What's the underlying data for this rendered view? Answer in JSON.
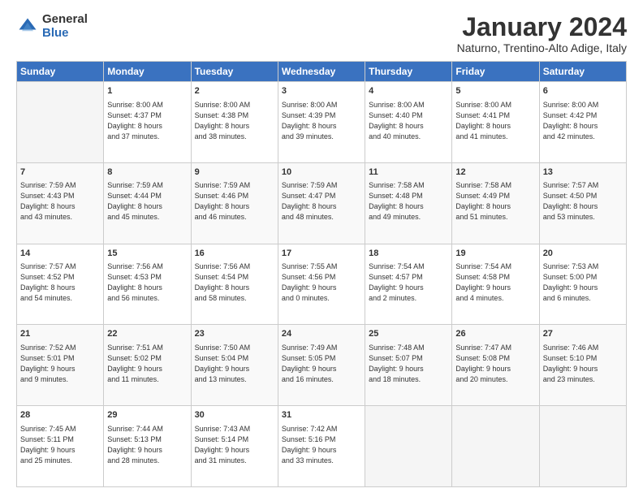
{
  "logo": {
    "general": "General",
    "blue": "Blue"
  },
  "title": "January 2024",
  "location": "Naturno, Trentino-Alto Adige, Italy",
  "weekdays": [
    "Sunday",
    "Monday",
    "Tuesday",
    "Wednesday",
    "Thursday",
    "Friday",
    "Saturday"
  ],
  "weeks": [
    [
      {
        "day": "",
        "info": ""
      },
      {
        "day": "1",
        "info": "Sunrise: 8:00 AM\nSunset: 4:37 PM\nDaylight: 8 hours\nand 37 minutes."
      },
      {
        "day": "2",
        "info": "Sunrise: 8:00 AM\nSunset: 4:38 PM\nDaylight: 8 hours\nand 38 minutes."
      },
      {
        "day": "3",
        "info": "Sunrise: 8:00 AM\nSunset: 4:39 PM\nDaylight: 8 hours\nand 39 minutes."
      },
      {
        "day": "4",
        "info": "Sunrise: 8:00 AM\nSunset: 4:40 PM\nDaylight: 8 hours\nand 40 minutes."
      },
      {
        "day": "5",
        "info": "Sunrise: 8:00 AM\nSunset: 4:41 PM\nDaylight: 8 hours\nand 41 minutes."
      },
      {
        "day": "6",
        "info": "Sunrise: 8:00 AM\nSunset: 4:42 PM\nDaylight: 8 hours\nand 42 minutes."
      }
    ],
    [
      {
        "day": "7",
        "info": "Sunrise: 7:59 AM\nSunset: 4:43 PM\nDaylight: 8 hours\nand 43 minutes."
      },
      {
        "day": "8",
        "info": "Sunrise: 7:59 AM\nSunset: 4:44 PM\nDaylight: 8 hours\nand 45 minutes."
      },
      {
        "day": "9",
        "info": "Sunrise: 7:59 AM\nSunset: 4:46 PM\nDaylight: 8 hours\nand 46 minutes."
      },
      {
        "day": "10",
        "info": "Sunrise: 7:59 AM\nSunset: 4:47 PM\nDaylight: 8 hours\nand 48 minutes."
      },
      {
        "day": "11",
        "info": "Sunrise: 7:58 AM\nSunset: 4:48 PM\nDaylight: 8 hours\nand 49 minutes."
      },
      {
        "day": "12",
        "info": "Sunrise: 7:58 AM\nSunset: 4:49 PM\nDaylight: 8 hours\nand 51 minutes."
      },
      {
        "day": "13",
        "info": "Sunrise: 7:57 AM\nSunset: 4:50 PM\nDaylight: 8 hours\nand 53 minutes."
      }
    ],
    [
      {
        "day": "14",
        "info": "Sunrise: 7:57 AM\nSunset: 4:52 PM\nDaylight: 8 hours\nand 54 minutes."
      },
      {
        "day": "15",
        "info": "Sunrise: 7:56 AM\nSunset: 4:53 PM\nDaylight: 8 hours\nand 56 minutes."
      },
      {
        "day": "16",
        "info": "Sunrise: 7:56 AM\nSunset: 4:54 PM\nDaylight: 8 hours\nand 58 minutes."
      },
      {
        "day": "17",
        "info": "Sunrise: 7:55 AM\nSunset: 4:56 PM\nDaylight: 9 hours\nand 0 minutes."
      },
      {
        "day": "18",
        "info": "Sunrise: 7:54 AM\nSunset: 4:57 PM\nDaylight: 9 hours\nand 2 minutes."
      },
      {
        "day": "19",
        "info": "Sunrise: 7:54 AM\nSunset: 4:58 PM\nDaylight: 9 hours\nand 4 minutes."
      },
      {
        "day": "20",
        "info": "Sunrise: 7:53 AM\nSunset: 5:00 PM\nDaylight: 9 hours\nand 6 minutes."
      }
    ],
    [
      {
        "day": "21",
        "info": "Sunrise: 7:52 AM\nSunset: 5:01 PM\nDaylight: 9 hours\nand 9 minutes."
      },
      {
        "day": "22",
        "info": "Sunrise: 7:51 AM\nSunset: 5:02 PM\nDaylight: 9 hours\nand 11 minutes."
      },
      {
        "day": "23",
        "info": "Sunrise: 7:50 AM\nSunset: 5:04 PM\nDaylight: 9 hours\nand 13 minutes."
      },
      {
        "day": "24",
        "info": "Sunrise: 7:49 AM\nSunset: 5:05 PM\nDaylight: 9 hours\nand 16 minutes."
      },
      {
        "day": "25",
        "info": "Sunrise: 7:48 AM\nSunset: 5:07 PM\nDaylight: 9 hours\nand 18 minutes."
      },
      {
        "day": "26",
        "info": "Sunrise: 7:47 AM\nSunset: 5:08 PM\nDaylight: 9 hours\nand 20 minutes."
      },
      {
        "day": "27",
        "info": "Sunrise: 7:46 AM\nSunset: 5:10 PM\nDaylight: 9 hours\nand 23 minutes."
      }
    ],
    [
      {
        "day": "28",
        "info": "Sunrise: 7:45 AM\nSunset: 5:11 PM\nDaylight: 9 hours\nand 25 minutes."
      },
      {
        "day": "29",
        "info": "Sunrise: 7:44 AM\nSunset: 5:13 PM\nDaylight: 9 hours\nand 28 minutes."
      },
      {
        "day": "30",
        "info": "Sunrise: 7:43 AM\nSunset: 5:14 PM\nDaylight: 9 hours\nand 31 minutes."
      },
      {
        "day": "31",
        "info": "Sunrise: 7:42 AM\nSunset: 5:16 PM\nDaylight: 9 hours\nand 33 minutes."
      },
      {
        "day": "",
        "info": ""
      },
      {
        "day": "",
        "info": ""
      },
      {
        "day": "",
        "info": ""
      }
    ]
  ]
}
